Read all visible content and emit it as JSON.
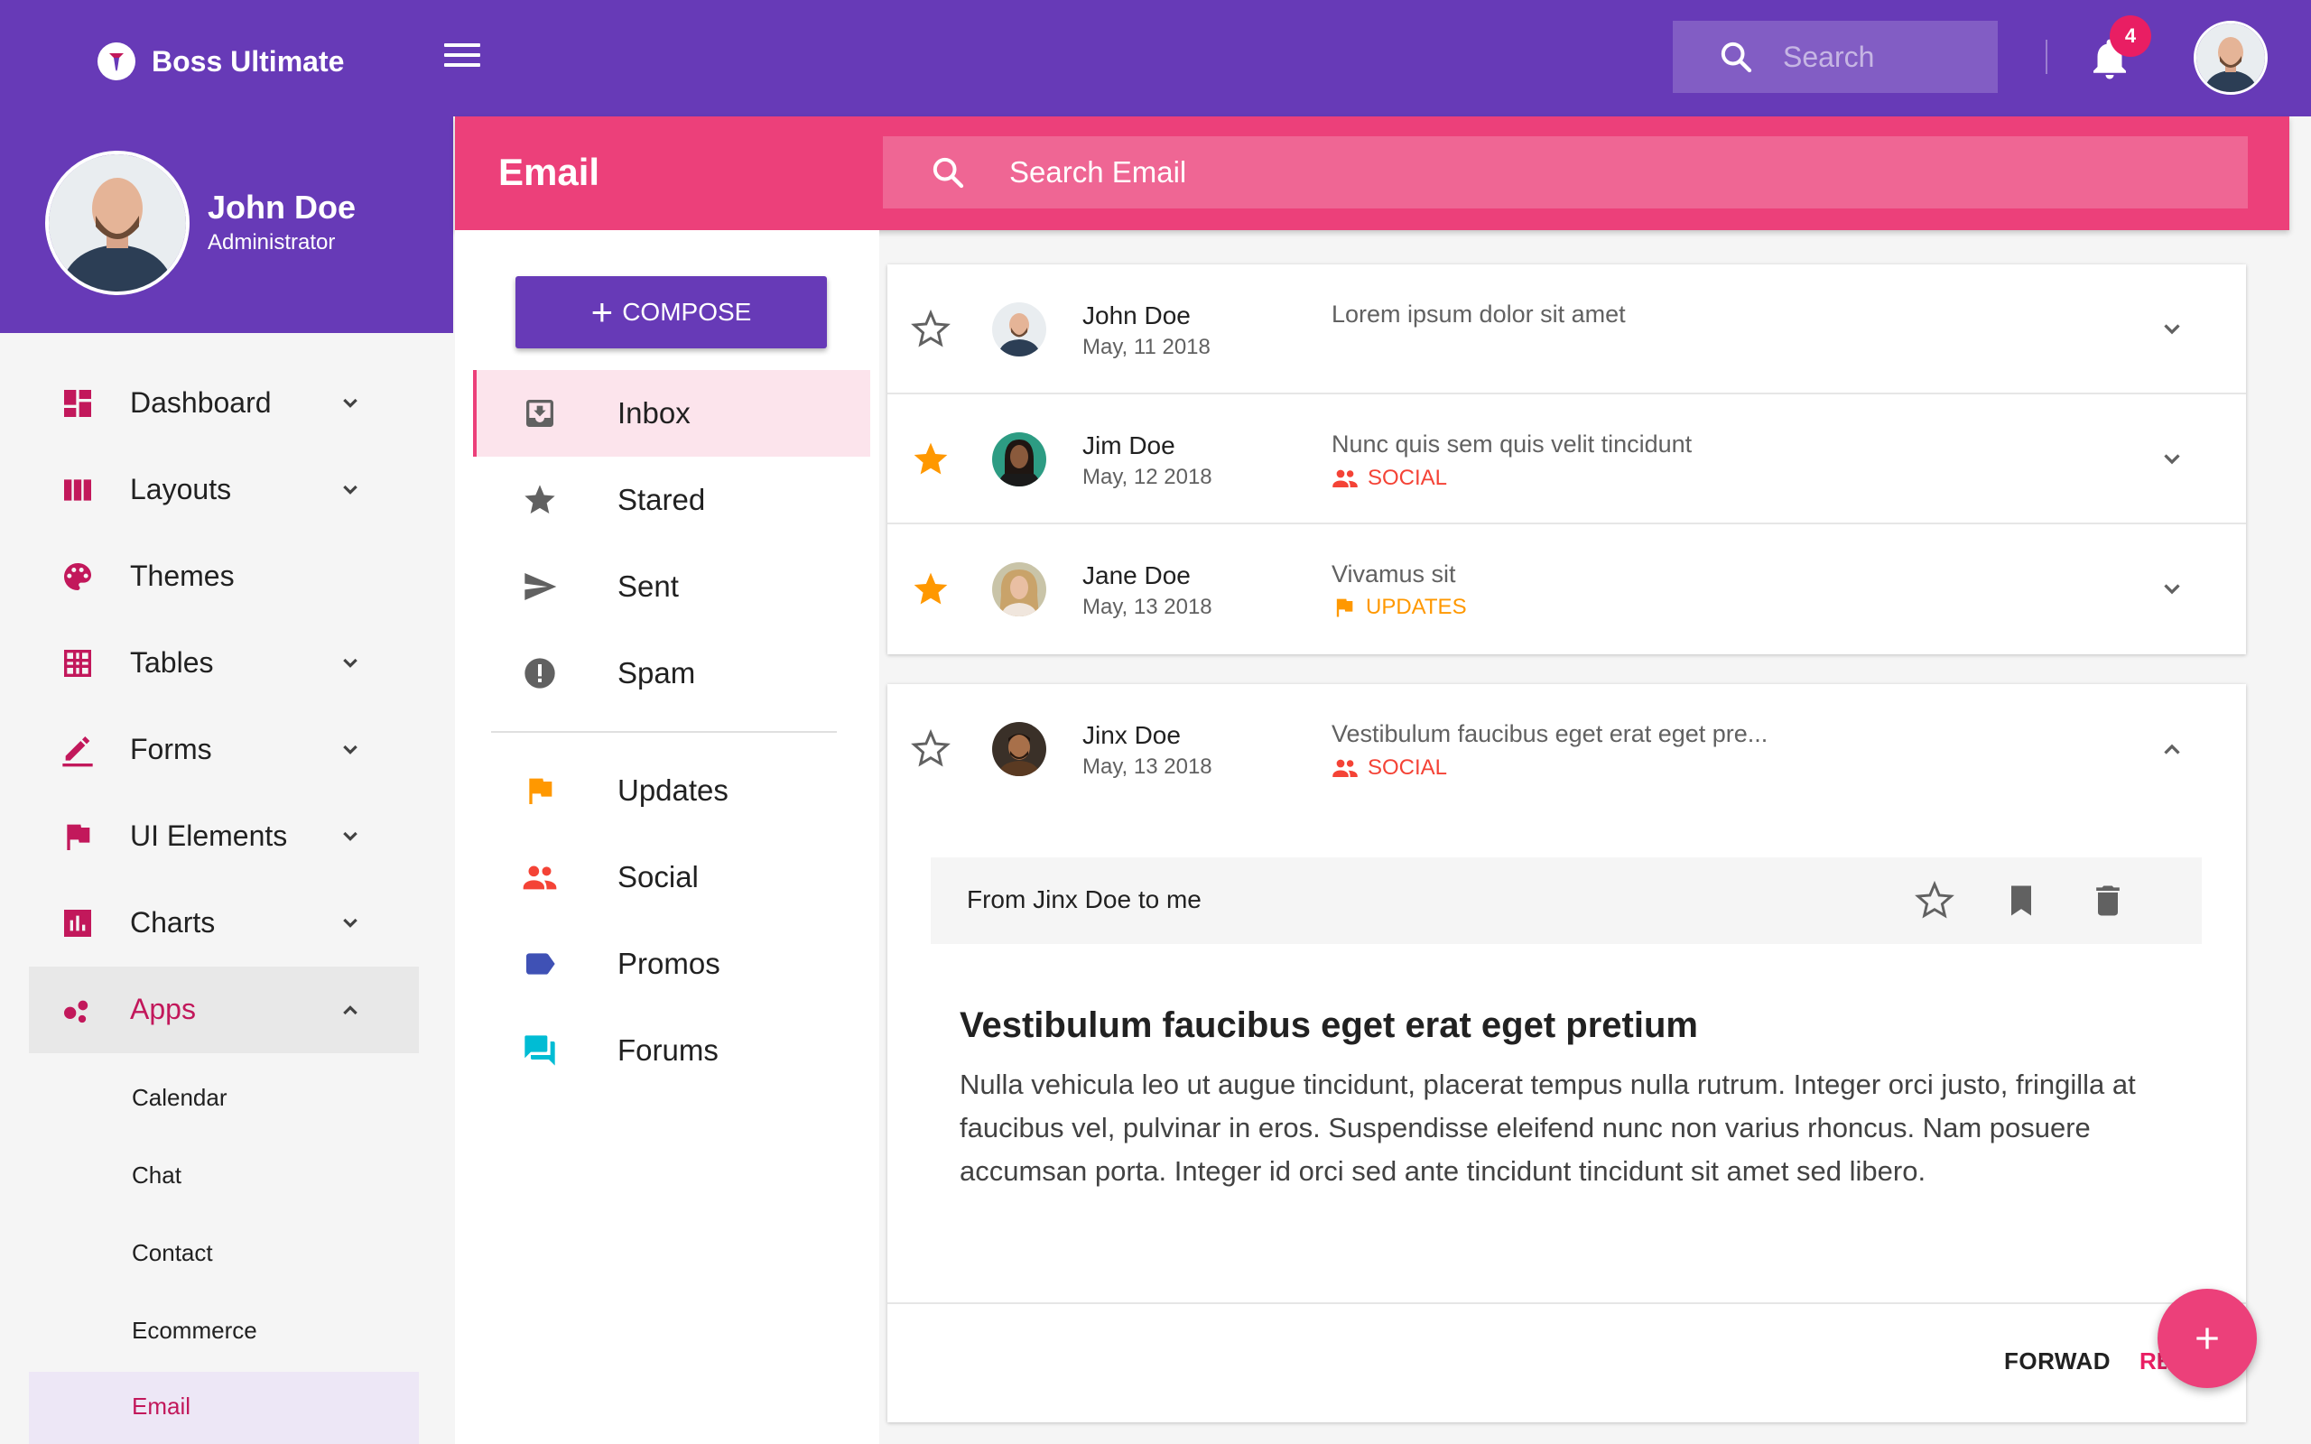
{
  "app": {
    "title": "Boss Ultimate"
  },
  "topbar": {
    "search_placeholder": "Search",
    "notification_count": "4"
  },
  "user": {
    "name": "John Doe",
    "role": "Administrator"
  },
  "sidebar": {
    "items": [
      {
        "label": "Dashboard",
        "icon": "dashboard-icon",
        "expandable": true
      },
      {
        "label": "Layouts",
        "icon": "layouts-icon",
        "expandable": true
      },
      {
        "label": "Themes",
        "icon": "palette-icon",
        "expandable": false
      },
      {
        "label": "Tables",
        "icon": "grid-icon",
        "expandable": true
      },
      {
        "label": "Forms",
        "icon": "pen-icon",
        "expandable": true
      },
      {
        "label": "UI Elements",
        "icon": "flag-icon",
        "expandable": true
      },
      {
        "label": "Charts",
        "icon": "bar-chart-icon",
        "expandable": true
      },
      {
        "label": "Apps",
        "icon": "bubbles-icon",
        "expandable": true,
        "open": true
      }
    ],
    "apps_children": [
      "Calendar",
      "Chat",
      "Contact",
      "Ecommerce",
      "Email"
    ],
    "active_child": "Email"
  },
  "email": {
    "title": "Email",
    "search_placeholder": "Search Email",
    "compose_label": "COMPOSE",
    "folders": [
      {
        "label": "Inbox",
        "icon": "inbox-icon",
        "active": true
      },
      {
        "label": "Stared",
        "icon": "star-icon"
      },
      {
        "label": "Sent",
        "icon": "send-icon"
      },
      {
        "label": "Spam",
        "icon": "spam-icon"
      }
    ],
    "labels": [
      {
        "label": "Updates",
        "icon": "flag-icon",
        "color": "#ff9800"
      },
      {
        "label": "Social",
        "icon": "people-icon",
        "color": "#f44336"
      },
      {
        "label": "Promos",
        "icon": "tag-icon",
        "color": "#3f51b5"
      },
      {
        "label": "Forums",
        "icon": "forum-icon",
        "color": "#00bcd4"
      }
    ],
    "messages": [
      {
        "sender": "John Doe",
        "date": "May, 11 2018",
        "subject": "Lorem ipsum dolor sit amet",
        "starred": false,
        "tag": ""
      },
      {
        "sender": "Jim Doe",
        "date": "May, 12 2018",
        "subject": "Nunc quis sem quis velit tincidunt",
        "starred": true,
        "tag": "SOCIAL"
      },
      {
        "sender": "Jane Doe",
        "date": "May, 13 2018",
        "subject": "Vivamus sit",
        "starred": true,
        "tag": "UPDATES"
      }
    ],
    "open_message": {
      "sender": "Jinx Doe",
      "date": "May, 13 2018",
      "subject": "Vestibulum faucibus eget erat eget pre...",
      "tag": "SOCIAL",
      "from_line": "From Jinx Doe to me",
      "title": "Vestibulum faucibus eget erat eget pretium",
      "body": "Nulla vehicula leo ut augue tincidunt, placerat tempus nulla rutrum. Integer orci justo, fringilla at faucibus vel, pulvinar in eros. Suspendisse eleifend nunc non varius rhoncus. Nam posuere accumsan porta. Integer id orci sed ante tincidunt tincidunt sit amet sed libero.",
      "forward_label": "FORWAD",
      "reply_label": "REPLY"
    }
  },
  "colors": {
    "primary": "#673ab7",
    "accent": "#ec407a",
    "star": "#ff9800",
    "social": "#f44336",
    "updates": "#ff9800",
    "nav_icon": "#c2185b"
  }
}
